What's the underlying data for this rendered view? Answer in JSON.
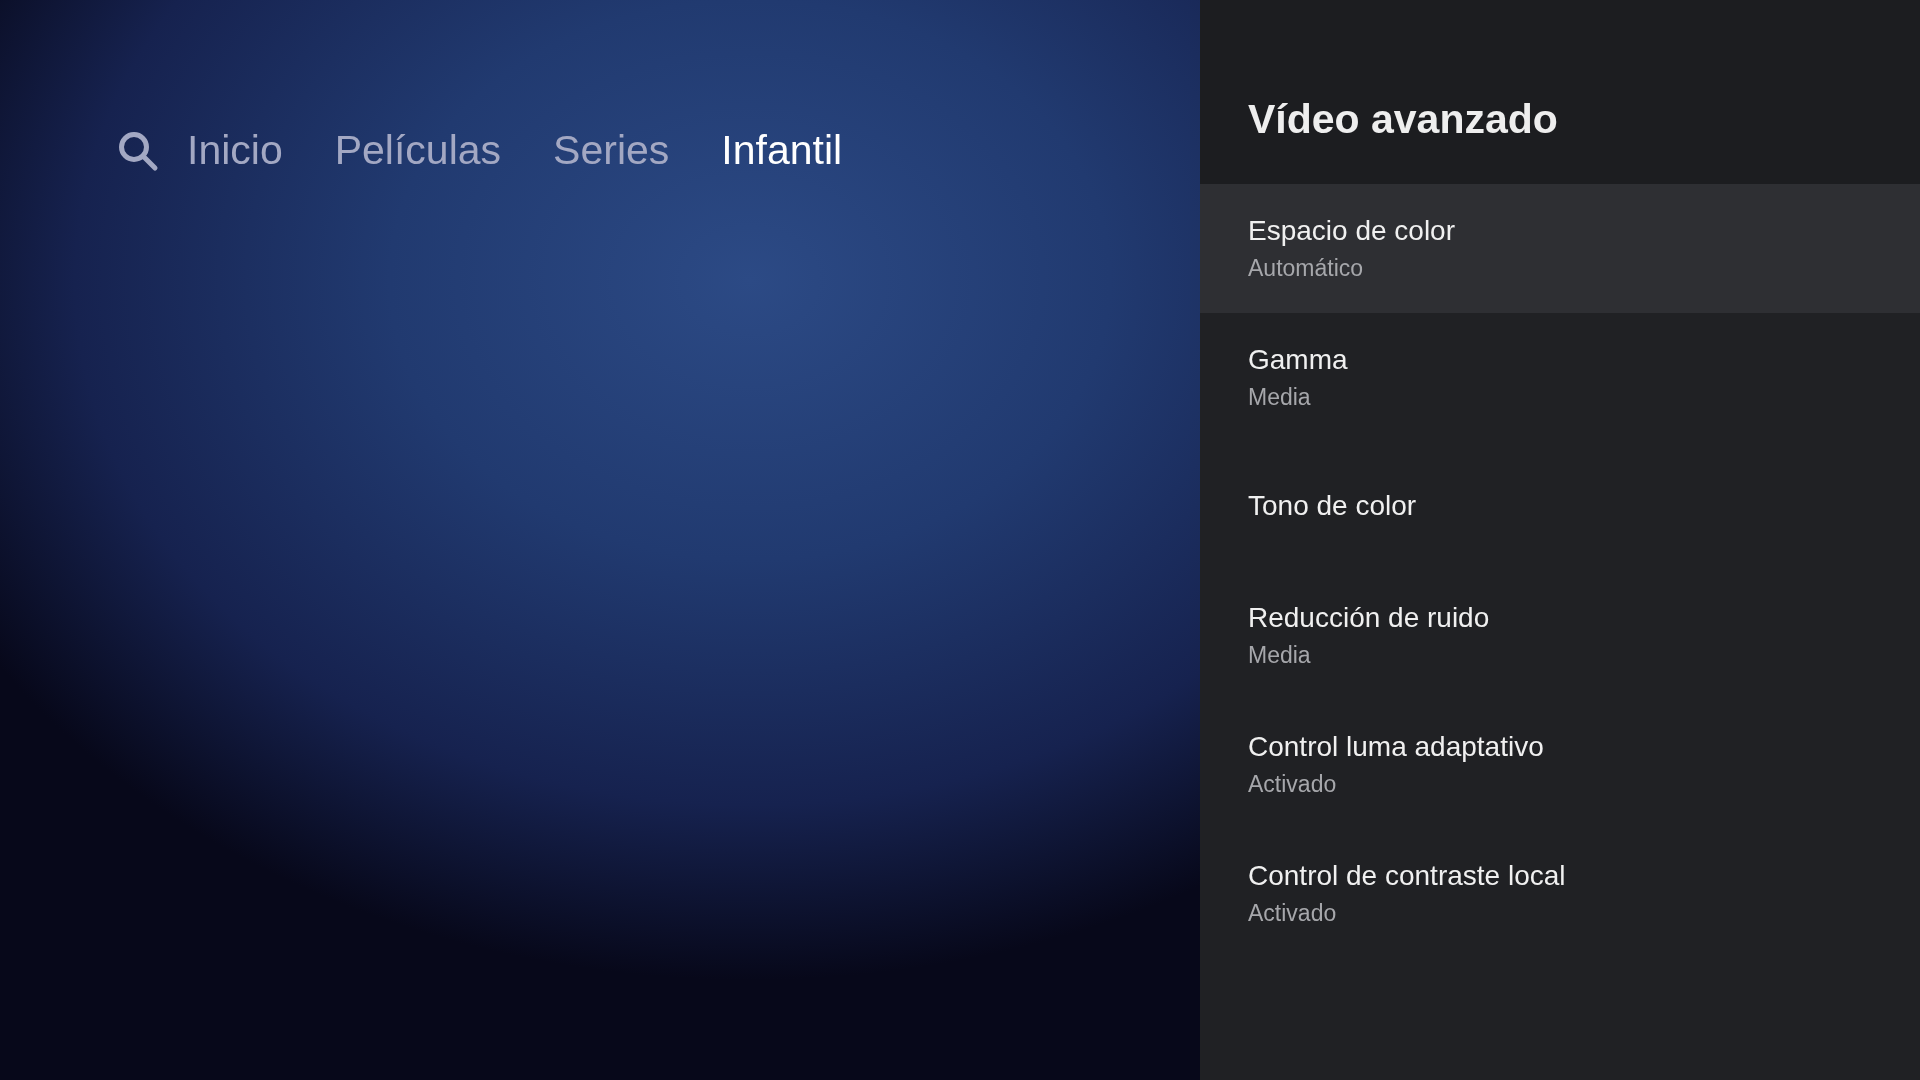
{
  "nav": {
    "tabs": [
      {
        "label": "Inicio",
        "selected": false
      },
      {
        "label": "Películas",
        "selected": false
      },
      {
        "label": "Series",
        "selected": false
      },
      {
        "label": "Infantil",
        "selected": true
      }
    ]
  },
  "panel": {
    "title": "Vídeo avanzado",
    "items": [
      {
        "title": "Espacio de color",
        "value": "Automático",
        "selected": true
      },
      {
        "title": "Gamma",
        "value": "Media",
        "selected": false
      },
      {
        "title": "Tono de color",
        "selected": false
      },
      {
        "title": "Reducción de ruido",
        "value": "Media",
        "selected": false
      },
      {
        "title": "Control luma adaptativo",
        "value": "Activado",
        "selected": false
      },
      {
        "title": "Control de contraste local",
        "value": "Activado",
        "selected": false
      }
    ]
  }
}
